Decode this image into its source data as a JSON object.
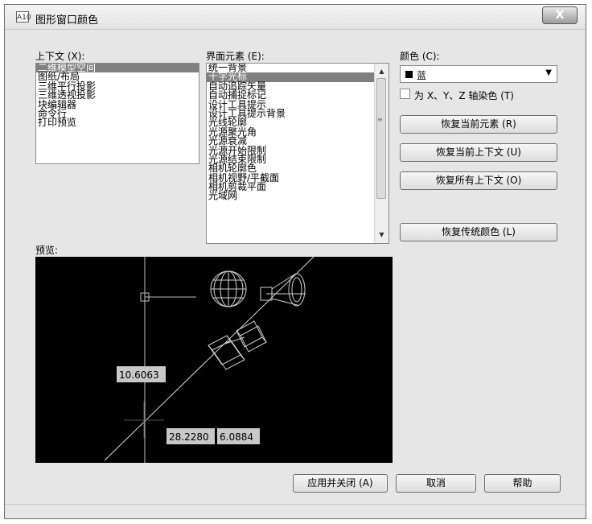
{
  "window": {
    "title": "图形窗口颜色",
    "app_icon": "A10",
    "close": "X"
  },
  "context": {
    "label": "上下文 (X):",
    "items": [
      "二维模型空间",
      "图纸/布局",
      "三维平行投影",
      "三维透视投影",
      "块编辑器",
      "命令行",
      "打印预览"
    ],
    "selected_index": 0
  },
  "elements": {
    "label": "界面元素 (E):",
    "items": [
      "统一背景",
      "十字光标",
      "自动追踪矢量",
      "自动捕捉标记",
      "设计工具提示",
      "设计工具提示背景",
      "光线轮廓",
      "光源聚光角",
      "光源衰减",
      "光源开始限制",
      "光源结束限制",
      "相机轮廓色",
      "相机视野/平截面",
      "相机剪裁平面",
      "光域网"
    ],
    "selected_index": 1
  },
  "color": {
    "label": "颜色 (C):",
    "selected": "蓝",
    "tint_label": "为 X、Y、Z 轴染色 (T)"
  },
  "buttons": {
    "restore_element": "恢复当前元素 (R)",
    "restore_context": "恢复当前上下文 (U)",
    "restore_all": "恢复所有上下文 (O)",
    "restore_classic": "恢复传统颜色 (L)",
    "apply_close": "应用并关闭 (A)",
    "cancel": "取消",
    "help": "帮助"
  },
  "preview": {
    "label": "预览:",
    "readout_1": "10.6063",
    "readout_2": "28.2280",
    "readout_3": "6.0884"
  }
}
